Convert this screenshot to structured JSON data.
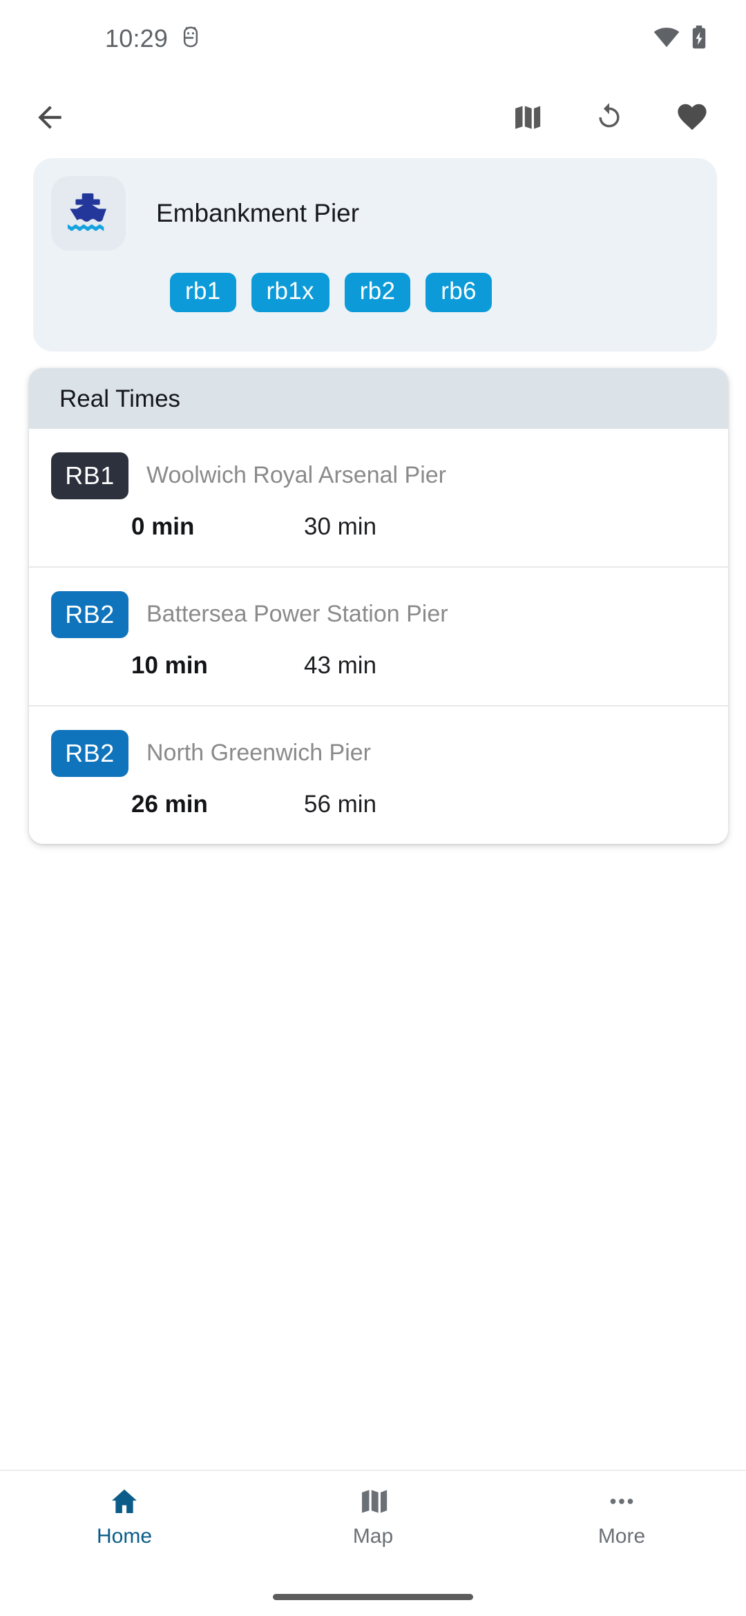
{
  "status_bar": {
    "time": "10:29",
    "icons": [
      "android-debug-icon",
      "wifi-icon",
      "battery-charging-icon"
    ]
  },
  "app_bar": {
    "back_label": "back-arrow-icon",
    "actions": [
      "map-icon",
      "refresh-icon",
      "favorite-heart-icon"
    ]
  },
  "stop": {
    "name": "Embankment Pier",
    "logo": "ferry-boat-icon",
    "routes": [
      "rb1",
      "rb1x",
      "rb2",
      "rb6"
    ]
  },
  "real_times": {
    "title": "Real Times",
    "rows": [
      {
        "route": "RB1",
        "route_color": "#2C313D",
        "destination": "Woolwich Royal Arsenal Pier",
        "time_primary": "0 min",
        "time_secondary": "30 min"
      },
      {
        "route": "RB2",
        "route_color": "#0F74BC",
        "destination": "Battersea Power Station Pier",
        "time_primary": "10 min",
        "time_secondary": "43 min"
      },
      {
        "route": "RB2",
        "route_color": "#0F74BC",
        "destination": "North Greenwich Pier",
        "time_primary": "26 min",
        "time_secondary": "56 min"
      }
    ]
  },
  "bottom_nav": {
    "items": [
      {
        "label": "Home",
        "icon": "home-icon",
        "active": true
      },
      {
        "label": "Map",
        "icon": "map-icon",
        "active": false
      },
      {
        "label": "More",
        "icon": "more-dots-icon",
        "active": false
      }
    ]
  },
  "colors": {
    "chip_blue": "#0C9BD8",
    "route_dark": "#2C313D",
    "route_blue": "#0F74BC",
    "nav_active": "#0B5C88",
    "card_header": "#DBE2E8",
    "stop_card_bg": "#EDF2F6"
  }
}
